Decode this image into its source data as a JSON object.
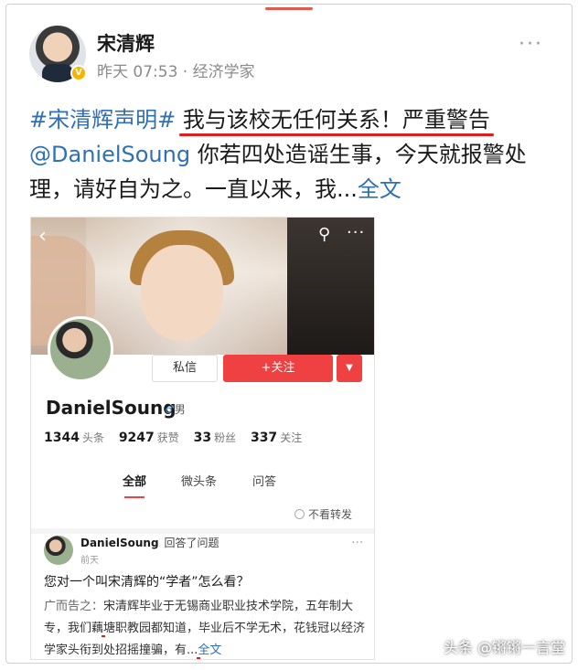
{
  "post": {
    "author_name": "宋清辉",
    "meta": "昨天  07:53 · 经济学家",
    "hashtag": "#宋清辉声明#",
    "headline": "我与该校无任何关系！严重警告",
    "mention": "@DanielSoung",
    "body": " 你若四处造谣生事，今天就报警处理，请好自为之。一直以来，我...",
    "full_text_link": "全文",
    "more": "···"
  },
  "embed": {
    "back": "‹",
    "search": "⚲",
    "more": "···",
    "message_button": "私信",
    "follow_button": "+关注",
    "dropdown": "▼",
    "username": "DanielSoung",
    "gender_symbol": "♂",
    "gender_label": "男",
    "stats": [
      {
        "num": "1344",
        "label": "头条"
      },
      {
        "num": "9247",
        "label": "获赞"
      },
      {
        "num": "33",
        "label": "粉丝"
      },
      {
        "num": "337",
        "label": "关注"
      }
    ],
    "tabs": [
      "全部",
      "微头条",
      "问答"
    ],
    "no_forward": "不看转发",
    "feed": {
      "user": "DanielSoung",
      "action": "回答了问题",
      "time": "前天",
      "more": "···",
      "question": "您对一个叫宋清辉的“学者”怎么看？",
      "answer_lead": "广而告之：",
      "answer_u1": "宋清辉毕业于无锡商业职业技术学院，五年制大专",
      "answer_mid": "，我们藕塘职教园都知道，",
      "answer_u2": "毕业后不学无术，花钱冠以经济学家头衔到处招摇撞骗",
      "answer_tail": "，有...",
      "full": "全文"
    }
  },
  "watermark": "头条 @锵锵一言堂"
}
